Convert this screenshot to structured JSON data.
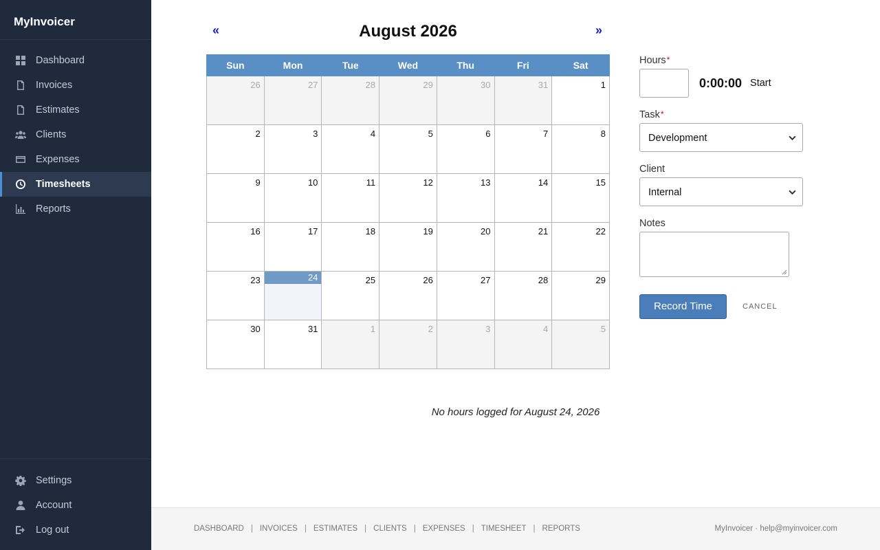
{
  "sidebar": {
    "brand": "MyInvoicer",
    "nav": [
      {
        "label": "Dashboard",
        "icon": "dashboard-icon",
        "active": false
      },
      {
        "label": "Invoices",
        "icon": "invoice-document-icon",
        "active": false
      },
      {
        "label": "Estimates",
        "icon": "estimate-document-icon",
        "active": false
      },
      {
        "label": "Clients",
        "icon": "users-icon",
        "active": false
      },
      {
        "label": "Expenses",
        "icon": "credit-card-icon",
        "active": false
      },
      {
        "label": "Timesheets",
        "icon": "clock-icon",
        "active": true
      },
      {
        "label": "Reports",
        "icon": "bar-chart-icon",
        "active": false
      }
    ],
    "bottom": [
      {
        "label": "Settings",
        "icon": "gear-icon"
      },
      {
        "label": "Account",
        "icon": "user-icon"
      },
      {
        "label": "Log out",
        "icon": "logout-icon"
      }
    ]
  },
  "calendar": {
    "title": "August 2026",
    "prev": "«",
    "next": "»",
    "weekdays": [
      "Sun",
      "Mon",
      "Tue",
      "Wed",
      "Thu",
      "Fri",
      "Sat"
    ],
    "weeks": [
      [
        {
          "d": "26",
          "o": true
        },
        {
          "d": "27",
          "o": true
        },
        {
          "d": "28",
          "o": true
        },
        {
          "d": "29",
          "o": true
        },
        {
          "d": "30",
          "o": true
        },
        {
          "d": "31",
          "o": true
        },
        {
          "d": "1"
        }
      ],
      [
        {
          "d": "2"
        },
        {
          "d": "3"
        },
        {
          "d": "4"
        },
        {
          "d": "5"
        },
        {
          "d": "6"
        },
        {
          "d": "7"
        },
        {
          "d": "8"
        }
      ],
      [
        {
          "d": "9"
        },
        {
          "d": "10"
        },
        {
          "d": "11"
        },
        {
          "d": "12"
        },
        {
          "d": "13"
        },
        {
          "d": "14"
        },
        {
          "d": "15"
        }
      ],
      [
        {
          "d": "16"
        },
        {
          "d": "17"
        },
        {
          "d": "18"
        },
        {
          "d": "19"
        },
        {
          "d": "20"
        },
        {
          "d": "21"
        },
        {
          "d": "22"
        }
      ],
      [
        {
          "d": "23"
        },
        {
          "d": "24",
          "sel": true
        },
        {
          "d": "25"
        },
        {
          "d": "26"
        },
        {
          "d": "27"
        },
        {
          "d": "28"
        },
        {
          "d": "29"
        }
      ],
      [
        {
          "d": "30"
        },
        {
          "d": "31"
        },
        {
          "d": "1",
          "o": true
        },
        {
          "d": "2",
          "o": true
        },
        {
          "d": "3",
          "o": true
        },
        {
          "d": "4",
          "o": true
        },
        {
          "d": "5",
          "o": true
        }
      ]
    ]
  },
  "status": {
    "no_hours": "No hours logged for August 24, 2026"
  },
  "form": {
    "hours_label": "Hours",
    "required_mark": "*",
    "hours_value": "",
    "timer": "0:00:00",
    "start": "Start",
    "task_label": "Task",
    "task_value": "Development",
    "client_label": "Client",
    "client_value": "Internal",
    "notes_label": "Notes",
    "notes_value": "",
    "record": "Record Time",
    "cancel": "CANCEL"
  },
  "footer": {
    "links": [
      "DASHBOARD",
      "INVOICES",
      "ESTIMATES",
      "CLIENTS",
      "EXPENSES",
      "TIMESHEET",
      "REPORTS"
    ],
    "separator": "|",
    "right": "MyInvoicer · help@myinvoicer.com"
  },
  "colors": {
    "sidebar_bg": "#1f2a3c",
    "header_blue": "#5a8fc5",
    "selected_day": "#6f9ac5",
    "primary_button": "#4a7ebb",
    "required": "#d0021b"
  }
}
